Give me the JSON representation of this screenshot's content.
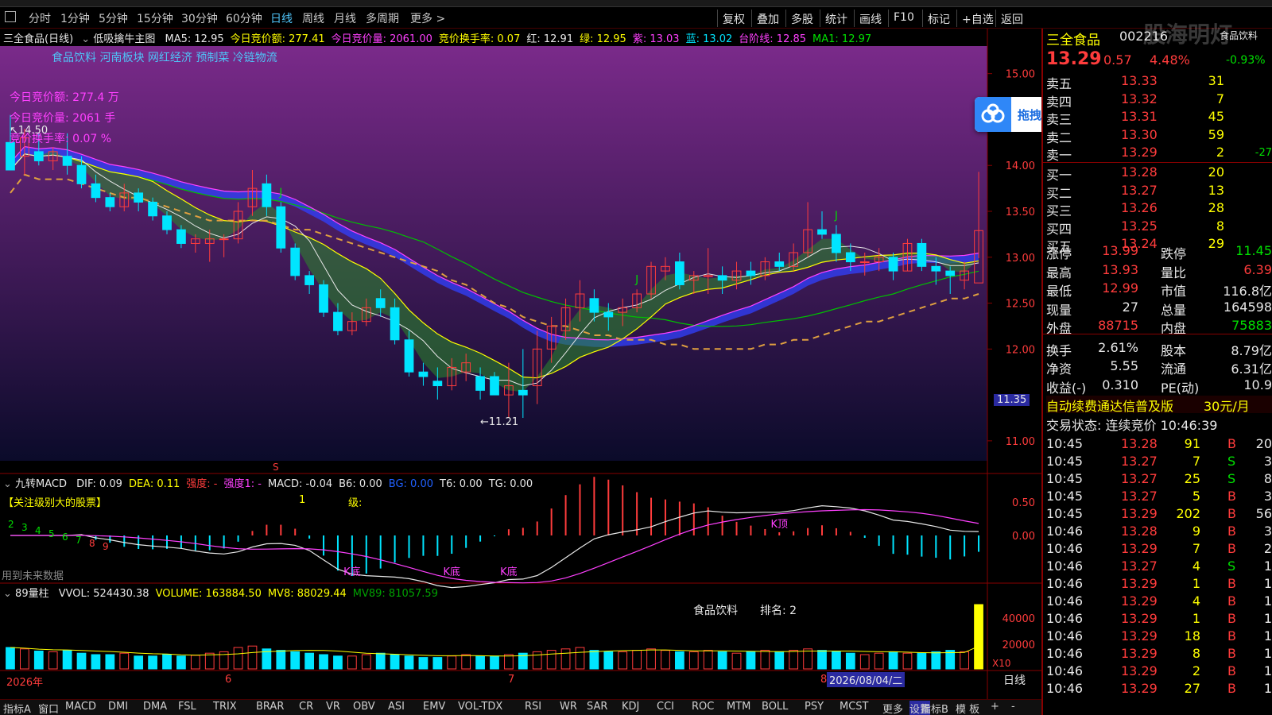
{
  "colors": {
    "up": "#ff3c3c",
    "down": "#00e5ff",
    "bg": "#000000",
    "main_bg_top": "#7a2a8a",
    "main_bg_bottom": "#0b0b2a"
  },
  "periods": [
    {
      "label": "分时",
      "active": false
    },
    {
      "label": "1分钟",
      "active": false
    },
    {
      "label": "5分钟",
      "active": false
    },
    {
      "label": "15分钟",
      "active": false
    },
    {
      "label": "30分钟",
      "active": false
    },
    {
      "label": "60分钟",
      "active": false
    },
    {
      "label": "日线",
      "active": true
    },
    {
      "label": "周线",
      "active": false
    },
    {
      "label": "月线",
      "active": false
    },
    {
      "label": "多周期",
      "active": false
    },
    {
      "label": "更多 >",
      "active": false
    }
  ],
  "right_buttons": [
    "复权",
    "叠加",
    "多股",
    "统计",
    "画线",
    "F10",
    "标记",
    "+自选",
    "返回"
  ],
  "main": {
    "title": "三全食品(日线)",
    "indicator": "低吸擒牛主图",
    "info": [
      {
        "text": "MA5: 12.95",
        "color": "#e8e8e8"
      },
      {
        "text": "今日竞价额: 277.41",
        "color": "#ffff00"
      },
      {
        "text": "今日竞价量: 2061.00",
        "color": "#ff40ff"
      },
      {
        "text": "竞价换手率: 0.07",
        "color": "#ffff00"
      },
      {
        "text": "红: 12.91",
        "color": "#e8e8e8"
      },
      {
        "text": "绿: 12.95",
        "color": "#ffff00"
      },
      {
        "text": "紫: 13.03",
        "color": "#ff40ff"
      },
      {
        "text": "蓝: 13.02",
        "color": "#00e5ff"
      },
      {
        "text": "台阶线: 12.85",
        "color": "#ff40ff"
      },
      {
        "text": "MA1: 12.97",
        "color": "#00e000"
      }
    ],
    "tags": "食品饮料 河南板块 网红经济 预制菜 冷链物流",
    "overlay": [
      "今日竞价额: 277.4 万",
      "今日竞价量: 2061 手",
      "竞价换手率: 0.07 %"
    ],
    "high_mark": "14.50",
    "low_mark": "11.21",
    "j_marker": "J",
    "price_axis": [
      "15.00",
      "14.00",
      "13.50",
      "13.00",
      "12.50",
      "12.00",
      "11.00"
    ],
    "price_box": "11.35"
  },
  "macd": {
    "title": "九转MACD",
    "info": [
      {
        "text": "DIF: 0.09",
        "color": "#e8e8e8"
      },
      {
        "text": "DEA: 0.11",
        "color": "#ffff00"
      },
      {
        "text": "强度: -",
        "color": "#ff3c3c"
      },
      {
        "text": "强度1: -",
        "color": "#ff40ff"
      },
      {
        "text": "MACD: -0.04",
        "color": "#e8e8e8"
      },
      {
        "text": "B6: 0.00",
        "color": "#e8e8e8"
      },
      {
        "text": "BG: 0.00",
        "color": "#2060ff"
      },
      {
        "text": "T6: 0.00",
        "color": "#e8e8e8"
      },
      {
        "text": "TG: 0.00",
        "color": "#e8e8e8"
      }
    ],
    "notice": "【关注级别大的股票】",
    "level_num": "1",
    "level_label": "级:",
    "future_note": "用到未来数据",
    "labels": {
      "kbottom": "K底",
      "ktop": "K顶"
    },
    "seq": [
      "2",
      "3",
      "4",
      "5",
      "6",
      "7",
      "8",
      "9"
    ],
    "axis": [
      "0.50",
      "0.00"
    ],
    "s_mark": "S"
  },
  "volume": {
    "title": "89量柱",
    "info": [
      {
        "text": "VVOL: 524430.38",
        "color": "#e8e8e8"
      },
      {
        "text": "VOLUME: 163884.50",
        "color": "#ffff00"
      },
      {
        "text": "MV8: 88029.44",
        "color": "#ffff00"
      },
      {
        "text": "MV89: 81057.59",
        "color": "#00a000"
      }
    ],
    "sector": "食品饮料",
    "rank": "排名: 2",
    "axis": [
      "40000",
      "20000"
    ],
    "unit": "X10"
  },
  "date_axis": {
    "year": "2026年",
    "m6": "6",
    "m7": "7",
    "m8": "8",
    "current": "2026/08/04/二",
    "period": "日线"
  },
  "tabs": [
    "指标A",
    "窗口",
    "MACD",
    "DMI",
    "DMA",
    "FSL",
    "TRIX",
    "BRAR",
    "CR",
    "VR",
    "OBV",
    "ASI",
    "EMV",
    "VOL-TDX",
    "RSI",
    "WR",
    "SAR",
    "KDJ",
    "CCI",
    "ROC",
    "MTM",
    "BOLL",
    "PSY",
    "MCST",
    "更多",
    "设置",
    "指标B",
    "模 板",
    "+",
    "-"
  ],
  "upload": {
    "label": "拖拽至此上传"
  },
  "watermark": "股海明灯",
  "quote": {
    "name": "三全食品",
    "code": "002216",
    "sector": "食品饮料",
    "price": "13.29",
    "change": "0.57",
    "pct": "4.48%",
    "rel": "-0.93%",
    "asks": [
      {
        "label": "卖五",
        "price": "13.33",
        "vol": "31"
      },
      {
        "label": "卖四",
        "price": "13.32",
        "vol": "7"
      },
      {
        "label": "卖三",
        "price": "13.31",
        "vol": "45"
      },
      {
        "label": "卖二",
        "price": "13.30",
        "vol": "59"
      },
      {
        "label": "卖一",
        "price": "13.29",
        "vol": "2",
        "extra": "-27"
      }
    ],
    "bids": [
      {
        "label": "买一",
        "price": "13.28",
        "vol": "20"
      },
      {
        "label": "买二",
        "price": "13.27",
        "vol": "13"
      },
      {
        "label": "买三",
        "price": "13.26",
        "vol": "28"
      },
      {
        "label": "买四",
        "price": "13.25",
        "vol": "8"
      },
      {
        "label": "买五",
        "price": "13.24",
        "vol": "29"
      }
    ],
    "stats": [
      {
        "k1": "涨停",
        "v1": "13.99",
        "c1": "#ff3c3c",
        "k2": "跌停",
        "v2": "11.45",
        "c2": "#00e000"
      },
      {
        "k1": "最高",
        "v1": "13.93",
        "c1": "#ff3c3c",
        "k2": "量比",
        "v2": "6.39",
        "c2": "#ff3c3c"
      },
      {
        "k1": "最低",
        "v1": "12.99",
        "c1": "#ff3c3c",
        "k2": "市值",
        "v2": "116.8亿",
        "c2": "#e8e8e8"
      },
      {
        "k1": "现量",
        "v1": "27",
        "c1": "#e8e8e8",
        "k2": "总量",
        "v2": "164598",
        "c2": "#e8e8e8"
      },
      {
        "k1": "外盘",
        "v1": "88715",
        "c1": "#ff3c3c",
        "k2": "内盘",
        "v2": "75883",
        "c2": "#00e000"
      },
      {
        "k1": "换手",
        "v1": "2.61%",
        "c1": "#e8e8e8",
        "k2": "股本",
        "v2": "8.79亿",
        "c2": "#e8e8e8"
      },
      {
        "k1": "净资",
        "v1": "5.55",
        "c1": "#e8e8e8",
        "k2": "流通",
        "v2": "6.31亿",
        "c2": "#e8e8e8"
      },
      {
        "k1": "收益(-)",
        "v1": "0.310",
        "c1": "#e8e8e8",
        "k2": "PE(动)",
        "v2": "10.9",
        "c2": "#e8e8e8"
      }
    ],
    "promo": "自动续费通达信普及版",
    "promo_price": "30元/月",
    "trade_status": "交易状态: 连续竞价 10:46:39",
    "ticks": [
      {
        "t": "10:45",
        "p": "13.28",
        "v": "91",
        "s": "B",
        "n": "20"
      },
      {
        "t": "10:45",
        "p": "13.27",
        "v": "7",
        "s": "S",
        "n": "3"
      },
      {
        "t": "10:45",
        "p": "13.27",
        "v": "25",
        "s": "S",
        "n": "8"
      },
      {
        "t": "10:45",
        "p": "13.27",
        "v": "5",
        "s": "B",
        "n": "3"
      },
      {
        "t": "10:45",
        "p": "13.29",
        "v": "202",
        "s": "B",
        "n": "56"
      },
      {
        "t": "10:46",
        "p": "13.28",
        "v": "9",
        "s": "B",
        "n": "3"
      },
      {
        "t": "10:46",
        "p": "13.29",
        "v": "7",
        "s": "B",
        "n": "2"
      },
      {
        "t": "10:46",
        "p": "13.27",
        "v": "4",
        "s": "S",
        "n": "1"
      },
      {
        "t": "10:46",
        "p": "13.29",
        "v": "1",
        "s": "B",
        "n": "1"
      },
      {
        "t": "10:46",
        "p": "13.29",
        "v": "4",
        "s": "B",
        "n": "1"
      },
      {
        "t": "10:46",
        "p": "13.29",
        "v": "1",
        "s": "B",
        "n": "1"
      },
      {
        "t": "10:46",
        "p": "13.29",
        "v": "18",
        "s": "B",
        "n": "1"
      },
      {
        "t": "10:46",
        "p": "13.29",
        "v": "8",
        "s": "B",
        "n": "1"
      },
      {
        "t": "10:46",
        "p": "13.29",
        "v": "2",
        "s": "B",
        "n": "1"
      },
      {
        "t": "10:46",
        "p": "13.29",
        "v": "27",
        "s": "B",
        "n": "1"
      }
    ]
  },
  "chart_data": {
    "type": "candlestick",
    "title": "三全食品(日线)",
    "ylim": [
      10.8,
      15.3
    ],
    "candles": [
      {
        "o": 14.25,
        "h": 14.55,
        "l": 13.95,
        "c": 13.95
      },
      {
        "o": 14.1,
        "h": 14.4,
        "l": 13.9,
        "c": 14.3
      },
      {
        "o": 14.15,
        "h": 14.35,
        "l": 14.0,
        "c": 14.05
      },
      {
        "o": 14.05,
        "h": 14.2,
        "l": 13.95,
        "c": 14.15
      },
      {
        "o": 14.1,
        "h": 14.35,
        "l": 13.9,
        "c": 14.0
      },
      {
        "o": 14.0,
        "h": 14.1,
        "l": 13.75,
        "c": 13.8
      },
      {
        "o": 13.8,
        "h": 13.9,
        "l": 13.6,
        "c": 13.65
      },
      {
        "o": 13.65,
        "h": 13.7,
        "l": 13.5,
        "c": 13.55
      },
      {
        "o": 13.55,
        "h": 13.8,
        "l": 13.5,
        "c": 13.7
      },
      {
        "o": 13.7,
        "h": 13.75,
        "l": 13.5,
        "c": 13.6
      },
      {
        "o": 13.6,
        "h": 13.65,
        "l": 13.4,
        "c": 13.45
      },
      {
        "o": 13.45,
        "h": 13.5,
        "l": 13.25,
        "c": 13.3
      },
      {
        "o": 13.3,
        "h": 13.35,
        "l": 13.1,
        "c": 13.15
      },
      {
        "o": 13.15,
        "h": 13.25,
        "l": 13.05,
        "c": 13.2
      },
      {
        "o": 13.15,
        "h": 13.3,
        "l": 12.95,
        "c": 13.2
      },
      {
        "o": 13.2,
        "h": 13.25,
        "l": 13.0,
        "c": 13.2
      },
      {
        "o": 13.2,
        "h": 13.6,
        "l": 13.15,
        "c": 13.5
      },
      {
        "o": 13.55,
        "h": 13.95,
        "l": 13.45,
        "c": 13.75
      },
      {
        "o": 13.8,
        "h": 13.9,
        "l": 13.45,
        "c": 13.55
      },
      {
        "o": 13.55,
        "h": 13.6,
        "l": 13.05,
        "c": 13.1
      },
      {
        "o": 13.1,
        "h": 13.15,
        "l": 12.75,
        "c": 12.8
      },
      {
        "o": 12.8,
        "h": 12.85,
        "l": 12.6,
        "c": 12.7
      },
      {
        "o": 12.7,
        "h": 12.75,
        "l": 12.35,
        "c": 12.4
      },
      {
        "o": 12.4,
        "h": 12.5,
        "l": 12.15,
        "c": 12.2
      },
      {
        "o": 12.2,
        "h": 12.4,
        "l": 12.15,
        "c": 12.3
      },
      {
        "o": 12.3,
        "h": 12.55,
        "l": 12.25,
        "c": 12.45
      },
      {
        "o": 12.55,
        "h": 12.65,
        "l": 12.35,
        "c": 12.45
      },
      {
        "o": 12.45,
        "h": 12.55,
        "l": 12.05,
        "c": 12.1
      },
      {
        "o": 12.1,
        "h": 12.2,
        "l": 11.7,
        "c": 11.75
      },
      {
        "o": 11.75,
        "h": 11.85,
        "l": 11.6,
        "c": 11.7
      },
      {
        "o": 11.65,
        "h": 11.8,
        "l": 11.45,
        "c": 11.6
      },
      {
        "o": 11.6,
        "h": 11.9,
        "l": 11.55,
        "c": 11.8
      },
      {
        "o": 11.75,
        "h": 11.95,
        "l": 11.65,
        "c": 11.85
      },
      {
        "o": 11.7,
        "h": 11.8,
        "l": 11.45,
        "c": 11.55
      },
      {
        "o": 11.7,
        "h": 11.75,
        "l": 11.5,
        "c": 11.5
      },
      {
        "o": 11.5,
        "h": 11.85,
        "l": 11.25,
        "c": 11.6
      },
      {
        "o": 11.55,
        "h": 12.0,
        "l": 11.25,
        "c": 11.5
      },
      {
        "o": 11.6,
        "h": 12.2,
        "l": 11.4,
        "c": 12.0
      },
      {
        "o": 12.0,
        "h": 12.35,
        "l": 11.85,
        "c": 12.25
      },
      {
        "o": 12.2,
        "h": 12.55,
        "l": 12.1,
        "c": 12.45
      },
      {
        "o": 12.45,
        "h": 12.75,
        "l": 12.3,
        "c": 12.6
      },
      {
        "o": 12.55,
        "h": 12.65,
        "l": 12.3,
        "c": 12.4
      },
      {
        "o": 12.4,
        "h": 12.5,
        "l": 12.2,
        "c": 12.35
      },
      {
        "o": 12.4,
        "h": 12.55,
        "l": 12.25,
        "c": 12.45
      },
      {
        "o": 12.45,
        "h": 12.65,
        "l": 12.4,
        "c": 12.6
      },
      {
        "o": 12.6,
        "h": 12.95,
        "l": 12.55,
        "c": 12.9
      },
      {
        "o": 12.85,
        "h": 13.0,
        "l": 12.75,
        "c": 12.9
      },
      {
        "o": 12.95,
        "h": 13.05,
        "l": 12.65,
        "c": 12.7
      },
      {
        "o": 12.75,
        "h": 12.85,
        "l": 12.6,
        "c": 12.8
      },
      {
        "o": 12.8,
        "h": 13.1,
        "l": 12.6,
        "c": 12.8
      },
      {
        "o": 12.8,
        "h": 12.9,
        "l": 12.6,
        "c": 12.75
      },
      {
        "o": 12.75,
        "h": 12.95,
        "l": 12.65,
        "c": 12.85
      },
      {
        "o": 12.85,
        "h": 12.95,
        "l": 12.7,
        "c": 12.8
      },
      {
        "o": 12.8,
        "h": 13.0,
        "l": 12.75,
        "c": 12.95
      },
      {
        "o": 12.95,
        "h": 13.05,
        "l": 12.85,
        "c": 12.9
      },
      {
        "o": 12.9,
        "h": 13.15,
        "l": 12.85,
        "c": 13.05
      },
      {
        "o": 13.05,
        "h": 13.6,
        "l": 13.0,
        "c": 13.3
      },
      {
        "o": 13.3,
        "h": 13.5,
        "l": 13.2,
        "c": 13.25
      },
      {
        "o": 13.25,
        "h": 13.35,
        "l": 12.95,
        "c": 13.05
      },
      {
        "o": 13.05,
        "h": 13.15,
        "l": 12.85,
        "c": 12.95
      },
      {
        "o": 12.95,
        "h": 13.05,
        "l": 12.8,
        "c": 12.95
      },
      {
        "o": 12.95,
        "h": 13.1,
        "l": 12.85,
        "c": 13.0
      },
      {
        "o": 13.0,
        "h": 13.05,
        "l": 12.75,
        "c": 12.85
      },
      {
        "o": 12.85,
        "h": 13.2,
        "l": 12.85,
        "c": 13.15
      },
      {
        "o": 13.15,
        "h": 13.2,
        "l": 12.85,
        "c": 12.9
      },
      {
        "o": 12.9,
        "h": 13.0,
        "l": 12.7,
        "c": 12.85
      },
      {
        "o": 12.85,
        "h": 12.9,
        "l": 12.6,
        "c": 12.8
      },
      {
        "o": 12.75,
        "h": 12.95,
        "l": 12.65,
        "c": 12.85
      },
      {
        "o": 12.72,
        "h": 13.93,
        "l": 12.99,
        "c": 13.29
      }
    ],
    "volumes": [
      30,
      28,
      25,
      24,
      26,
      22,
      20,
      20,
      22,
      18,
      18,
      20,
      18,
      19,
      22,
      24,
      30,
      32,
      28,
      26,
      24,
      22,
      20,
      18,
      18,
      20,
      22,
      20,
      18,
      16,
      16,
      18,
      20,
      18,
      18,
      20,
      22,
      24,
      26,
      28,
      30,
      26,
      24,
      24,
      26,
      28,
      26,
      24,
      24,
      26,
      24,
      22,
      24,
      26,
      24,
      26,
      28,
      26,
      24,
      22,
      20,
      22,
      24,
      22,
      22,
      24,
      26,
      24,
      90
    ]
  }
}
